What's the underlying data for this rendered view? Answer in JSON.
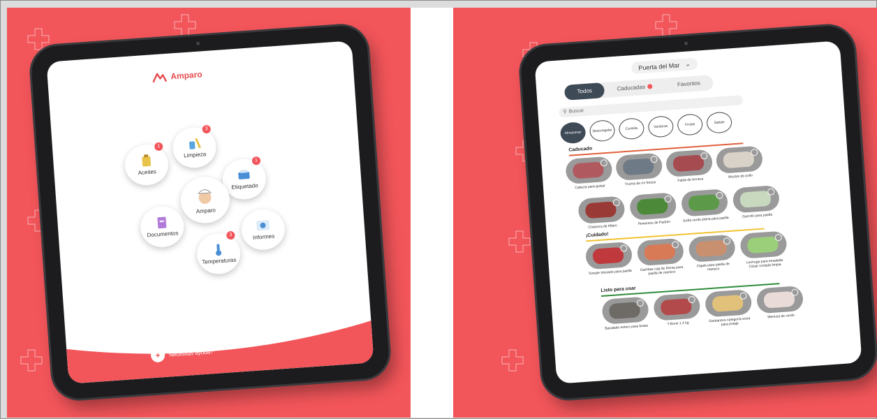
{
  "left": {
    "app_name": "Amparo",
    "bubbles": [
      {
        "label": "Aceites",
        "badge": "1",
        "icon": "oil-icon"
      },
      {
        "label": "Limpieza",
        "badge": "3",
        "icon": "cleaning-icon"
      },
      {
        "label": "Etiquetado",
        "badge": "1",
        "icon": "label-printer-icon"
      },
      {
        "label": "Amparo",
        "badge": "",
        "icon": "chef-icon"
      },
      {
        "label": "Documentos",
        "badge": "",
        "icon": "document-icon"
      },
      {
        "label": "Informes",
        "badge": "",
        "icon": "report-icon"
      },
      {
        "label": "Temperaturas",
        "badge": "3",
        "icon": "thermometer-icon"
      }
    ],
    "help_label": "Necesitas ayuda?"
  },
  "right": {
    "location": "Puerta del Mar",
    "tabs": [
      {
        "label": "Todos",
        "active": true
      },
      {
        "label": "Caducadas",
        "dot": true
      },
      {
        "label": "Favoritos"
      }
    ],
    "search_placeholder": "Buscar",
    "chips": [
      "Almacenar",
      "Descongelar",
      "Comida",
      "Verduras",
      "Frutas",
      "Salsas"
    ],
    "sections": [
      {
        "title": "Caducado",
        "color": "#e0603c",
        "products": [
          "Cabeza para guisar",
          "Trucha de río fresca",
          "Falda de ternera",
          "Muslos de pollo"
        ]
      },
      {
        "title": "",
        "color": "",
        "products": [
          "Chistorra de Alfaro",
          "Pimientos de Padrón",
          "Judía verde plana para paella",
          "Garrofó para paella"
        ]
      },
      {
        "title": "¡Cuidado!",
        "color": "#f2c230",
        "products": [
          "Tomate triturado para paella",
          "Gambas roja de Denia para paella de marisco",
          "Cigala para paella de marisco",
          "Lechuga para ensalada César cortada limpia"
        ]
      },
      {
        "title": "Listo para usar",
        "color": "#2e8b3a",
        "products": [
          "Bacalado entero para brasa",
          "T-Bone 1.2 kg",
          "Garbanzos categoría extra para potaje",
          "Merluza de cerdo"
        ]
      }
    ]
  },
  "colors": {
    "brand": "#f2555a",
    "dark": "#3f4a57"
  }
}
